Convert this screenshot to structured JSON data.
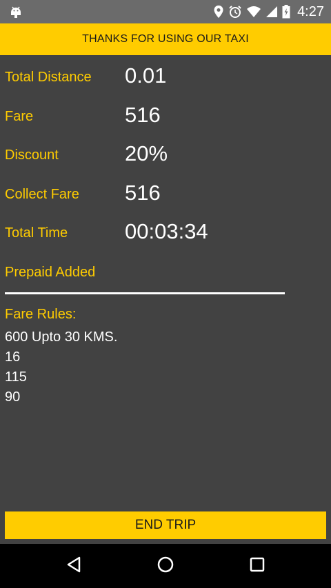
{
  "status_bar": {
    "time": "4:27",
    "icons": [
      "android-icon",
      "location-icon",
      "alarm-icon",
      "wifi-icon",
      "signal-icon",
      "battery-icon"
    ]
  },
  "header": {
    "title": "THANKS FOR USING OUR TAXI"
  },
  "summary": {
    "total_distance": {
      "label": "Total Distance",
      "value": "0.01"
    },
    "fare": {
      "label": "Fare",
      "value": "516"
    },
    "discount": {
      "label": "Discount",
      "value": "20%"
    },
    "collect_fare": {
      "label": "Collect Fare",
      "value": "516"
    },
    "total_time": {
      "label": "Total Time",
      "value": "00:03:34"
    },
    "prepaid": {
      "label": "Prepaid Added"
    }
  },
  "fare_rules": {
    "title": "Fare Rules:",
    "lines": [
      "600 Upto 30 KMS.",
      "16",
      "115",
      "90"
    ]
  },
  "actions": {
    "end_trip_label": "END TRIP"
  },
  "nav_bar": {
    "buttons": [
      "back-icon",
      "home-icon",
      "recents-icon"
    ]
  },
  "colors": {
    "accent": "#ffcc00",
    "background": "#424242",
    "status_bar": "#6b6b6b"
  }
}
